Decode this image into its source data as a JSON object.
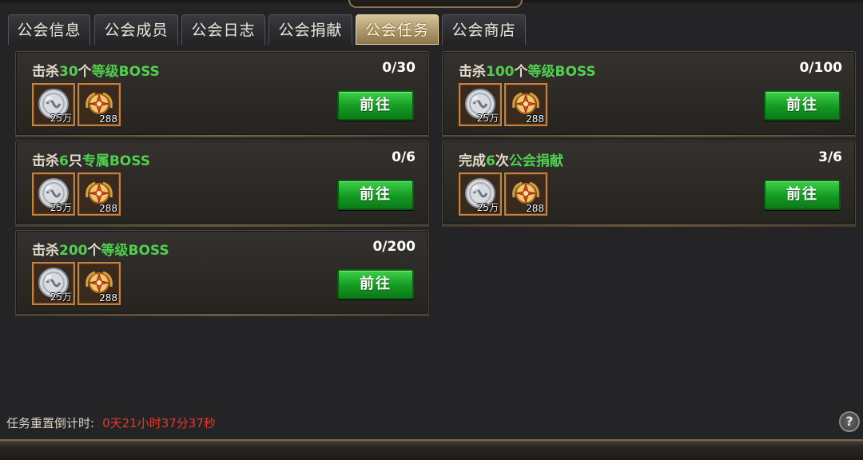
{
  "tabs": [
    {
      "label": "公会信息"
    },
    {
      "label": "公会成员"
    },
    {
      "label": "公会日志"
    },
    {
      "label": "公会捐献"
    },
    {
      "label": "公会任务",
      "active": true
    },
    {
      "label": "公会商店"
    }
  ],
  "tasks": [
    {
      "title_pre": "击杀",
      "title_num": "30",
      "title_mid": "个",
      "title_hl": "等级BOSS",
      "progress": "0/30",
      "rewards": [
        {
          "icon": "silver-coin-icon",
          "qty": "25万"
        },
        {
          "icon": "guild-medal-icon",
          "qty": "288"
        }
      ],
      "button": "前往"
    },
    {
      "title_pre": "击杀",
      "title_num": "100",
      "title_mid": "个",
      "title_hl": "等级BOSS",
      "progress": "0/100",
      "rewards": [
        {
          "icon": "silver-coin-icon",
          "qty": "25万"
        },
        {
          "icon": "guild-medal-icon",
          "qty": "288"
        }
      ],
      "button": "前往"
    },
    {
      "title_pre": "击杀",
      "title_num": "6",
      "title_mid": "只",
      "title_hl": "专属BOSS",
      "progress": "0/6",
      "rewards": [
        {
          "icon": "silver-coin-icon",
          "qty": "25万"
        },
        {
          "icon": "guild-medal-icon",
          "qty": "288"
        }
      ],
      "button": "前往"
    },
    {
      "title_pre": "完成",
      "title_num": "6",
      "title_mid": "次",
      "title_hl": "公会捐献",
      "progress": "3/6",
      "rewards": [
        {
          "icon": "silver-coin-icon",
          "qty": "25万"
        },
        {
          "icon": "guild-medal-icon",
          "qty": "288"
        }
      ],
      "button": "前往"
    },
    {
      "title_pre": "击杀",
      "title_num": "200",
      "title_mid": "个",
      "title_hl": "等级BOSS",
      "progress": "0/200",
      "rewards": [
        {
          "icon": "silver-coin-icon",
          "qty": "25万"
        },
        {
          "icon": "guild-medal-icon",
          "qty": "288"
        }
      ],
      "button": "前往"
    }
  ],
  "footer": {
    "countdown_label": "任务重置倒计时:",
    "countdown_value": "0天21小时37分37秒",
    "help_label": "?"
  },
  "colors": {
    "highlight_green": "#4fd04f",
    "countdown_red": "#e53a2a",
    "button_green": "#149a22",
    "active_tab_gold": "#d6c49a"
  }
}
